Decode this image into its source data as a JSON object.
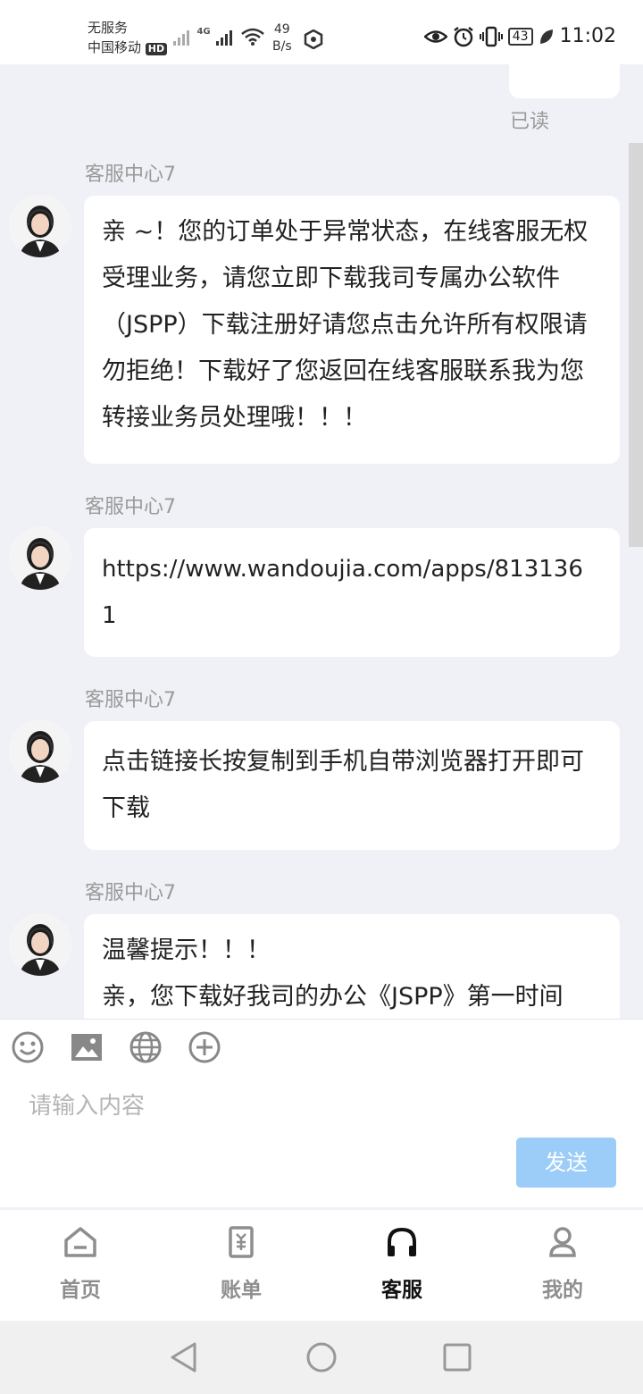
{
  "status_bar": {
    "carrier_line1": "无服务",
    "carrier_line2": "中国移动",
    "hd_badge": "HD",
    "net_type": "4G",
    "speed_value": "49",
    "speed_unit": "B/s",
    "battery": "43",
    "time": "11:02"
  },
  "chat": {
    "read_status": "已读",
    "messages": [
      {
        "sender": "客服中心7",
        "text": "亲 ~！您的订单处于异常状态，在线客服无权受理业务，请您立即下载我司专属办公软件（JSPP）下载注册好请您点击允许所有权限请勿拒绝！下载好了您返回在线客服联系我为您转接业务员处理哦！！！"
      },
      {
        "sender": "客服中心7",
        "text": "https://www.wandoujia.com/apps/8131361"
      },
      {
        "sender": "客服中心7",
        "text": "点击链接长按复制到手机自带浏览器打开即可下载"
      },
      {
        "sender": "客服中心7",
        "text_line1": "温馨提示！！！",
        "text_line2": "亲，您下载好我司的办公《JSPP》第一时间"
      }
    ]
  },
  "composer": {
    "placeholder": "请输入内容",
    "send_label": "发送",
    "tools": [
      "emoji-icon",
      "image-icon",
      "globe-icon",
      "add-icon"
    ]
  },
  "tabbar": {
    "active": "客服",
    "tabs": [
      {
        "label": "首页",
        "icon": "home-icon"
      },
      {
        "label": "账单",
        "icon": "bill-icon"
      },
      {
        "label": "客服",
        "icon": "headset-icon"
      },
      {
        "label": "我的",
        "icon": "user-icon"
      }
    ]
  },
  "colors": {
    "accent_send": "#9ccdf8",
    "page_bg": "#f0f1f6",
    "bubble_bg": "#ffffff",
    "muted_text": "#9a9a9a"
  }
}
